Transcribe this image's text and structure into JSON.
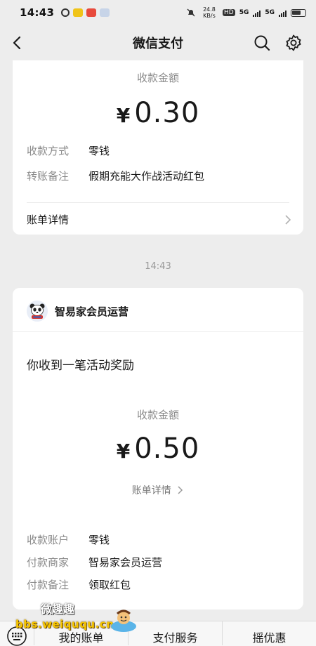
{
  "status_bar": {
    "time": "14:43",
    "speed": "24.8 KB/s",
    "network": "5G",
    "network2": "5G"
  },
  "navbar": {
    "title": "微信支付",
    "back_icon": "chevron-left-icon",
    "search_icon": "search-icon",
    "settings_icon": "gear-icon"
  },
  "card1": {
    "amount_label": "收款金额",
    "currency": "¥",
    "amount": "0.30",
    "rows": [
      {
        "key": "收款方式",
        "value": "零钱"
      },
      {
        "key": "转账备注",
        "value": "假期充能大作战活动红包"
      }
    ],
    "bill_detail": "账单详情"
  },
  "time_separator": "14:43",
  "card2": {
    "merchant_name": "智易家会员运营",
    "headline": "你收到一笔活动奖励",
    "amount_label": "收款金额",
    "currency": "¥",
    "amount": "0.50",
    "bill_detail": "账单详情",
    "rows": [
      {
        "key": "收款账户",
        "value": "零钱"
      },
      {
        "key": "付款商家",
        "value": "智易家会员运营"
      },
      {
        "key": "付款备注",
        "value": "领取红包"
      }
    ]
  },
  "bottom_bar": {
    "tabs": [
      "我的账单",
      "支付服务",
      "摇优惠"
    ]
  },
  "watermark": {
    "title": "微趣趣",
    "url": "bbs.weiququ.cn"
  },
  "colors": {
    "background": "#ededed",
    "card": "#ffffff",
    "text": "#191919",
    "muted": "#8a8a8a"
  }
}
